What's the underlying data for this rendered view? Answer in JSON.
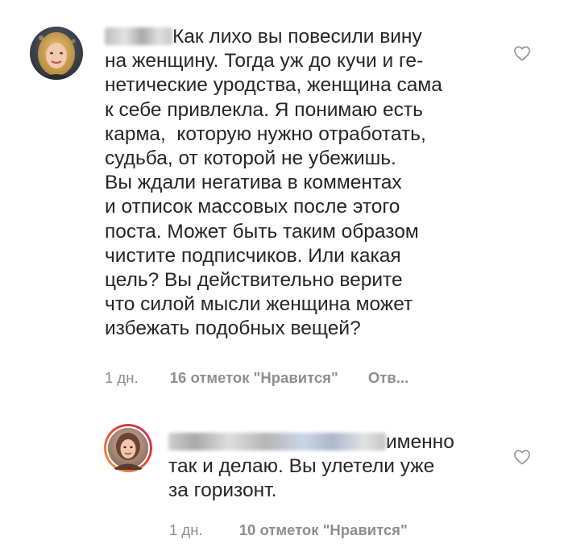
{
  "comments": [
    {
      "text": "Как лихо вы повесили вину\nна женщину. Тогда уж до кучи и ге-\nнетические уродства, женщина сама\nк себе привлекла. Я понимаю есть\nкарма,  которую нужно отработать,\nсудьба, от которой не убежишь.\nВы ждали негатива в комментах\nи отписок массовых после этого\nпоста. Может быть таким образом\nчистите подписчиков. Или какая\nцель? Вы действительно верите\nчто силой мысли женщина может\nизбежать подобных вещей?",
      "time": "1 дн.",
      "likes": "16 отметок \"Нравится\"",
      "reply": "Отв..."
    },
    {
      "text": "именно\nтак и делаю. Вы улетели уже\nза горизонт.",
      "time": "1 дн.",
      "likes": "10 отметок \"Нравится\""
    }
  ],
  "icons": {
    "like": "heart-outline-icon"
  },
  "colors": {
    "text": "#262626",
    "meta": "#8e8e8e",
    "story_ring_start": "#f9a03f",
    "story_ring_end": "#d62976"
  }
}
